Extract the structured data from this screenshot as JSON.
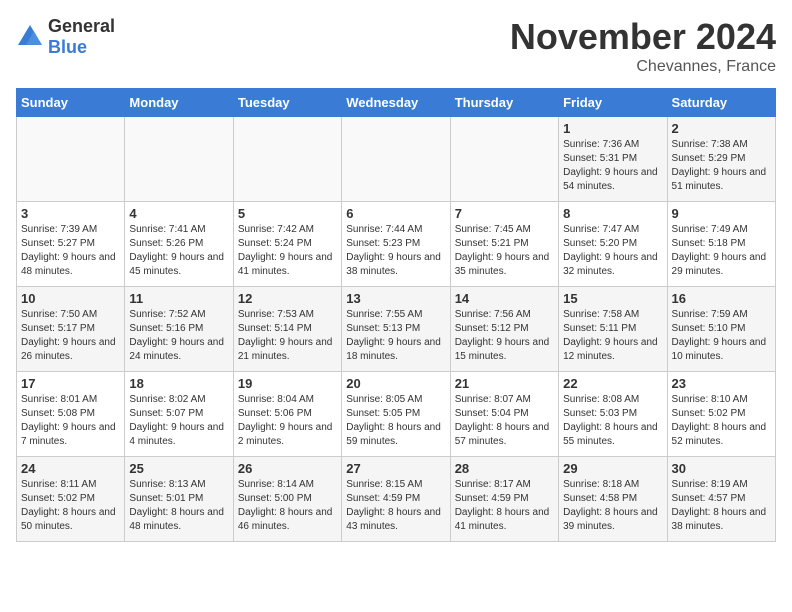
{
  "header": {
    "logo_general": "General",
    "logo_blue": "Blue",
    "title": "November 2024",
    "subtitle": "Chevannes, France"
  },
  "days_of_week": [
    "Sunday",
    "Monday",
    "Tuesday",
    "Wednesday",
    "Thursday",
    "Friday",
    "Saturday"
  ],
  "weeks": [
    [
      {
        "day": "",
        "info": ""
      },
      {
        "day": "",
        "info": ""
      },
      {
        "day": "",
        "info": ""
      },
      {
        "day": "",
        "info": ""
      },
      {
        "day": "",
        "info": ""
      },
      {
        "day": "1",
        "info": "Sunrise: 7:36 AM\nSunset: 5:31 PM\nDaylight: 9 hours and 54 minutes."
      },
      {
        "day": "2",
        "info": "Sunrise: 7:38 AM\nSunset: 5:29 PM\nDaylight: 9 hours and 51 minutes."
      }
    ],
    [
      {
        "day": "3",
        "info": "Sunrise: 7:39 AM\nSunset: 5:27 PM\nDaylight: 9 hours and 48 minutes."
      },
      {
        "day": "4",
        "info": "Sunrise: 7:41 AM\nSunset: 5:26 PM\nDaylight: 9 hours and 45 minutes."
      },
      {
        "day": "5",
        "info": "Sunrise: 7:42 AM\nSunset: 5:24 PM\nDaylight: 9 hours and 41 minutes."
      },
      {
        "day": "6",
        "info": "Sunrise: 7:44 AM\nSunset: 5:23 PM\nDaylight: 9 hours and 38 minutes."
      },
      {
        "day": "7",
        "info": "Sunrise: 7:45 AM\nSunset: 5:21 PM\nDaylight: 9 hours and 35 minutes."
      },
      {
        "day": "8",
        "info": "Sunrise: 7:47 AM\nSunset: 5:20 PM\nDaylight: 9 hours and 32 minutes."
      },
      {
        "day": "9",
        "info": "Sunrise: 7:49 AM\nSunset: 5:18 PM\nDaylight: 9 hours and 29 minutes."
      }
    ],
    [
      {
        "day": "10",
        "info": "Sunrise: 7:50 AM\nSunset: 5:17 PM\nDaylight: 9 hours and 26 minutes."
      },
      {
        "day": "11",
        "info": "Sunrise: 7:52 AM\nSunset: 5:16 PM\nDaylight: 9 hours and 24 minutes."
      },
      {
        "day": "12",
        "info": "Sunrise: 7:53 AM\nSunset: 5:14 PM\nDaylight: 9 hours and 21 minutes."
      },
      {
        "day": "13",
        "info": "Sunrise: 7:55 AM\nSunset: 5:13 PM\nDaylight: 9 hours and 18 minutes."
      },
      {
        "day": "14",
        "info": "Sunrise: 7:56 AM\nSunset: 5:12 PM\nDaylight: 9 hours and 15 minutes."
      },
      {
        "day": "15",
        "info": "Sunrise: 7:58 AM\nSunset: 5:11 PM\nDaylight: 9 hours and 12 minutes."
      },
      {
        "day": "16",
        "info": "Sunrise: 7:59 AM\nSunset: 5:10 PM\nDaylight: 9 hours and 10 minutes."
      }
    ],
    [
      {
        "day": "17",
        "info": "Sunrise: 8:01 AM\nSunset: 5:08 PM\nDaylight: 9 hours and 7 minutes."
      },
      {
        "day": "18",
        "info": "Sunrise: 8:02 AM\nSunset: 5:07 PM\nDaylight: 9 hours and 4 minutes."
      },
      {
        "day": "19",
        "info": "Sunrise: 8:04 AM\nSunset: 5:06 PM\nDaylight: 9 hours and 2 minutes."
      },
      {
        "day": "20",
        "info": "Sunrise: 8:05 AM\nSunset: 5:05 PM\nDaylight: 8 hours and 59 minutes."
      },
      {
        "day": "21",
        "info": "Sunrise: 8:07 AM\nSunset: 5:04 PM\nDaylight: 8 hours and 57 minutes."
      },
      {
        "day": "22",
        "info": "Sunrise: 8:08 AM\nSunset: 5:03 PM\nDaylight: 8 hours and 55 minutes."
      },
      {
        "day": "23",
        "info": "Sunrise: 8:10 AM\nSunset: 5:02 PM\nDaylight: 8 hours and 52 minutes."
      }
    ],
    [
      {
        "day": "24",
        "info": "Sunrise: 8:11 AM\nSunset: 5:02 PM\nDaylight: 8 hours and 50 minutes."
      },
      {
        "day": "25",
        "info": "Sunrise: 8:13 AM\nSunset: 5:01 PM\nDaylight: 8 hours and 48 minutes."
      },
      {
        "day": "26",
        "info": "Sunrise: 8:14 AM\nSunset: 5:00 PM\nDaylight: 8 hours and 46 minutes."
      },
      {
        "day": "27",
        "info": "Sunrise: 8:15 AM\nSunset: 4:59 PM\nDaylight: 8 hours and 43 minutes."
      },
      {
        "day": "28",
        "info": "Sunrise: 8:17 AM\nSunset: 4:59 PM\nDaylight: 8 hours and 41 minutes."
      },
      {
        "day": "29",
        "info": "Sunrise: 8:18 AM\nSunset: 4:58 PM\nDaylight: 8 hours and 39 minutes."
      },
      {
        "day": "30",
        "info": "Sunrise: 8:19 AM\nSunset: 4:57 PM\nDaylight: 8 hours and 38 minutes."
      }
    ]
  ]
}
